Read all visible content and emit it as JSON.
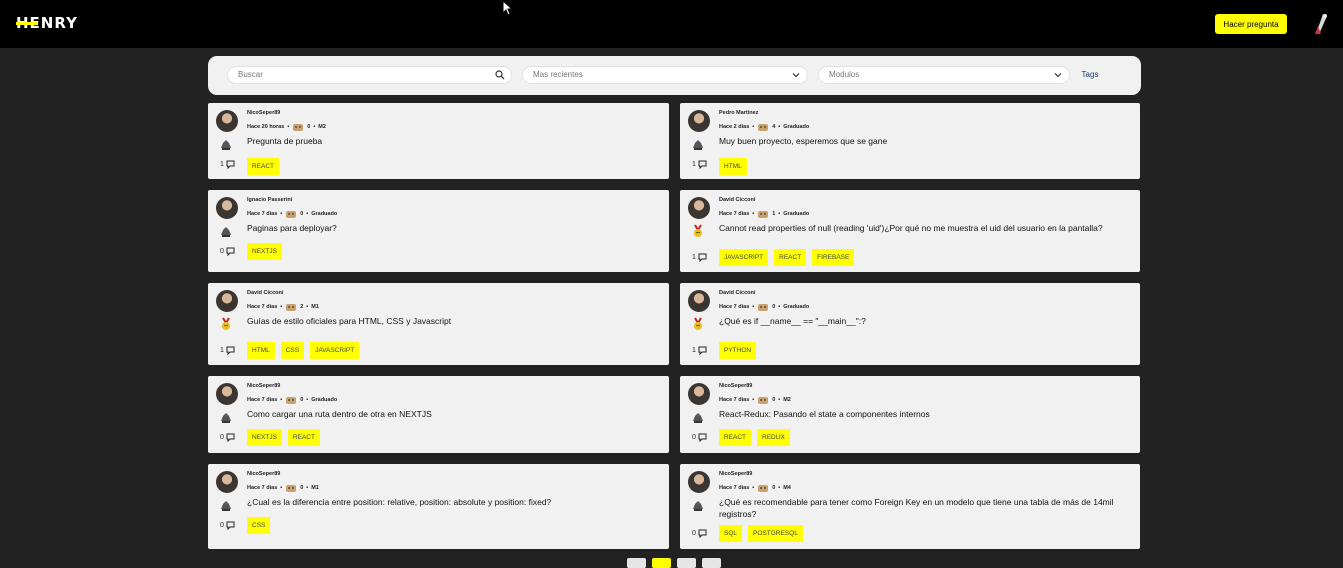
{
  "header": {
    "logo": "HENRY",
    "ask_button": "Hacer pregunta",
    "accent": "#ffff01"
  },
  "filters": {
    "search_placeholder": "Buscar",
    "sort_selected": "Mas recientes",
    "modules_selected": "Modulos",
    "tags_label": "Tags"
  },
  "questions": [
    {
      "user": "NicoSeper89",
      "time": "Hace 20 horas",
      "points": "0",
      "level": "M2",
      "title": "Pregunta de prueba",
      "answers": "1",
      "tags": [
        "REACT"
      ]
    },
    {
      "user": "Pedro Martinez",
      "time": "Hace 2 dias",
      "points": "4",
      "level": "Graduado",
      "title": "Muy buen proyecto, esperemos que se gane",
      "answers": "1",
      "tags": [
        "HTML"
      ]
    },
    {
      "user": "Ignacio Passerini",
      "time": "Hace 7 dias",
      "points": "0",
      "level": "Graduado",
      "title": "Paginas para deployar?",
      "answers": "0",
      "tags": [
        "NEXTJS"
      ]
    },
    {
      "user": "David Cicconi",
      "time": "Hace 7 dias",
      "points": "1",
      "level": "Graduado",
      "title": "Cannot read properties of null (reading 'uid')¿Por qué no me muestra el uid del usuario en la pantalla?",
      "answers": "1",
      "tags": [
        "JAVASCRIPT",
        "REACT",
        "FIREBASE"
      ]
    },
    {
      "user": "David Cicconi",
      "time": "Hace 7 dias",
      "points": "2",
      "level": "M1",
      "title": "Guías de estilo oficiales para HTML, CSS y Javascript",
      "answers": "1",
      "tags": [
        "HTML",
        "CSS",
        "JAVASCRIPT"
      ]
    },
    {
      "user": "David Cicconi",
      "time": "Hace 7 dias",
      "points": "0",
      "level": "Graduado",
      "title": "¿Qué es if __name__ == \"__main__\":?",
      "answers": "1",
      "tags": [
        "PYTHON"
      ]
    },
    {
      "user": "NicoSeper89",
      "time": "Hace 7 dias",
      "points": "0",
      "level": "Graduado",
      "title": "Como cargar una ruta dentro de otra en NEXTJS",
      "answers": "0",
      "tags": [
        "NEXTJS",
        "REACT"
      ]
    },
    {
      "user": "NicoSeper89",
      "time": "Hace 7 dias",
      "points": "0",
      "level": "M2",
      "title": "React-Redux: Pasando el state a componentes internos",
      "answers": "0",
      "tags": [
        "REACT",
        "REDUX"
      ]
    },
    {
      "user": "NicoSeper89",
      "time": "Hace 7 dias",
      "points": "0",
      "level": "M1",
      "title": "¿Cual es la diferencia entre position: relative, position: absolute y position: fixed?",
      "answers": "0",
      "tags": [
        "CSS"
      ]
    },
    {
      "user": "NicoSeper89",
      "time": "Hace 7 dias",
      "points": "0",
      "level": "M4",
      "title": "¿Qué es recomendable para tener como Foreign Key en un modelo que tiene una tabla de más de 14mil registros?",
      "answers": "0",
      "tags": [
        "SQL",
        "POSTGRESQL"
      ]
    }
  ],
  "pagination": {
    "active_color": "#ffff01",
    "inactive_color": "#e6e6e6"
  }
}
